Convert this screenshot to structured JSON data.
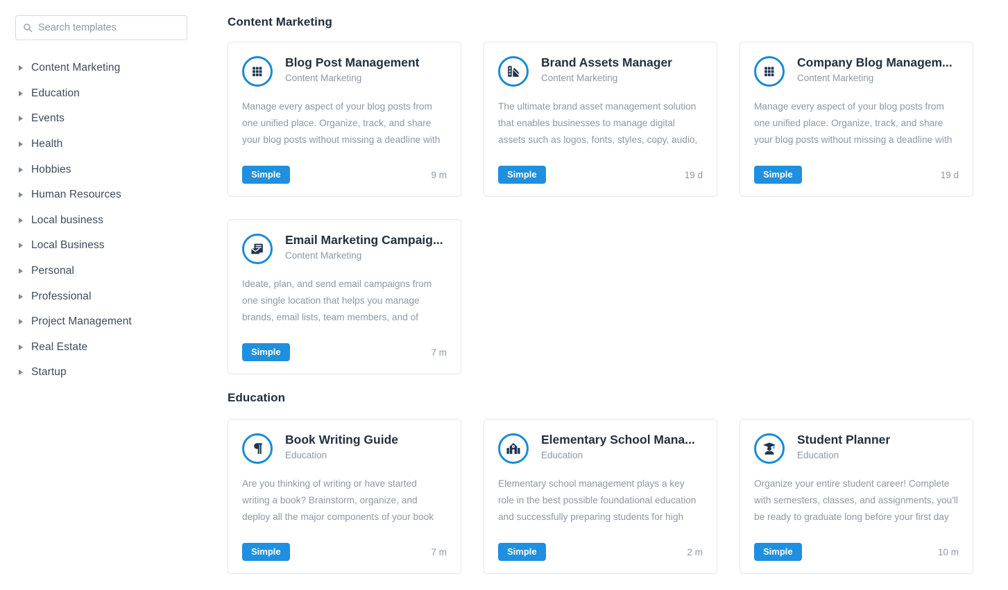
{
  "colors": {
    "accent": "#1f8fe0",
    "icon_ring": "#1b8ad6",
    "icon_dark": "#1f3550",
    "text_primary": "#22303f",
    "text_muted": "#8c98a4",
    "card_border": "#e1e6ea"
  },
  "search": {
    "placeholder": "Search templates",
    "value": "",
    "icon": "search-icon"
  },
  "sidebar": {
    "items": [
      {
        "label": "Content Marketing",
        "icon": "caret-right-icon"
      },
      {
        "label": "Education",
        "icon": "caret-right-icon"
      },
      {
        "label": "Events",
        "icon": "caret-right-icon"
      },
      {
        "label": "Health",
        "icon": "caret-right-icon"
      },
      {
        "label": "Hobbies",
        "icon": "caret-right-icon"
      },
      {
        "label": "Human Resources",
        "icon": "caret-right-icon"
      },
      {
        "label": "Local business",
        "icon": "caret-right-icon"
      },
      {
        "label": "Local Business",
        "icon": "caret-right-icon"
      },
      {
        "label": "Personal",
        "icon": "caret-right-icon"
      },
      {
        "label": "Professional",
        "icon": "caret-right-icon"
      },
      {
        "label": "Project Management",
        "icon": "caret-right-icon"
      },
      {
        "label": "Real Estate",
        "icon": "caret-right-icon"
      },
      {
        "label": "Startup",
        "icon": "caret-right-icon"
      }
    ]
  },
  "sections": [
    {
      "title": "Content Marketing",
      "cards": [
        {
          "title": "Blog Post Management",
          "category": "Content Marketing",
          "description": "Manage every aspect of your blog posts from one unified place. Organize, track, and share your blog posts without missing a deadline with",
          "badge": "Simple",
          "age": "9 m",
          "icon": "grid-icon"
        },
        {
          "title": "Brand Assets Manager",
          "category": "Content Marketing",
          "description": "The ultimate brand asset management solution that enables businesses to manage digital assets such as logos, fonts, styles, copy, audio,",
          "badge": "Simple",
          "age": "19 d",
          "icon": "palette-swatch-icon"
        },
        {
          "title": "Company Blog Managem...",
          "category": "Content Marketing",
          "description": "Manage every aspect of your blog posts from one unified place. Organize, track, and share your blog posts without missing a deadline with",
          "badge": "Simple",
          "age": "19 d",
          "icon": "grid-icon"
        },
        {
          "title": "Email Marketing Campaig...",
          "category": "Content Marketing",
          "description": "Ideate, plan, and send email campaigns from one single location that helps you manage brands, email lists, team members, and of",
          "badge": "Simple",
          "age": "7 m",
          "icon": "email-stack-icon"
        }
      ]
    },
    {
      "title": "Education",
      "cards": [
        {
          "title": "Book Writing Guide",
          "category": "Education",
          "description": "Are you thinking of writing or have started writing a book? Brainstorm, organize, and deploy all the major components of your book",
          "badge": "Simple",
          "age": "7 m",
          "icon": "paragraph-icon"
        },
        {
          "title": "Elementary School Mana...",
          "category": "Education",
          "description": "Elementary school management plays a key role in the best possible foundational education and successfully preparing students for high",
          "badge": "Simple",
          "age": "2 m",
          "icon": "school-building-icon"
        },
        {
          "title": "Student Planner",
          "category": "Education",
          "description": "Organize your entire student career! Complete with semesters, classes, and assignments, you'll be ready to graduate long before your first day",
          "badge": "Simple",
          "age": "10 m",
          "icon": "graduate-icon"
        }
      ]
    }
  ]
}
